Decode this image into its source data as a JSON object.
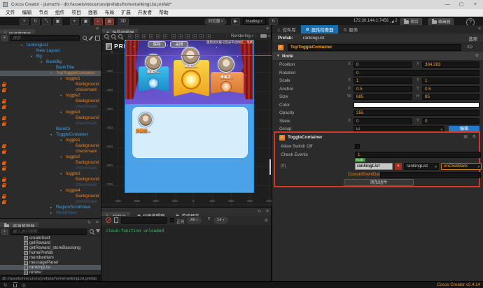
{
  "window": {
    "title": "Cocos Creator - jiumozhi - db://assets/resources/prefabs/home/rankingList.prefab*",
    "minimize": "—",
    "maximize": "▢",
    "close": "×"
  },
  "menu": {
    "items": [
      "文件",
      "编辑",
      "节点",
      "组件",
      "项目",
      "面板",
      "布局",
      "扩展",
      "开发者",
      "帮助"
    ]
  },
  "toolbar": {
    "preview_target": "浏览器",
    "play": "▶",
    "scene": "loading",
    "address": "172.30.144.1:7456",
    "device_count": "2",
    "project": "项目",
    "editor": "编辑器",
    "mode_3d": "3D"
  },
  "hierarchy": {
    "title": "层级管理器",
    "search_placeholder": "搜索...",
    "nodes": [
      {
        "label": "rankingList",
        "indent": 0,
        "arrow": "▾",
        "color": "blue"
      },
      {
        "label": "New Layout",
        "indent": 1,
        "arrow": "",
        "color": "blue"
      },
      {
        "label": "Bg",
        "indent": 1,
        "arrow": "▾",
        "color": "blue"
      },
      {
        "label": "BankBg",
        "indent": 2,
        "arrow": "▾",
        "color": "blue"
      },
      {
        "label": "BankTitle",
        "indent": 3,
        "arrow": "",
        "color": "blue"
      },
      {
        "label": "TopToggleContainer",
        "indent": 3,
        "arrow": "▾",
        "color": "orange",
        "selected": true
      },
      {
        "label": "toggle1",
        "indent": 4,
        "arrow": "▾",
        "color": "orange"
      },
      {
        "label": "Background",
        "indent": 5,
        "arrow": "",
        "color": "orange",
        "locked": true
      },
      {
        "label": "checkmark",
        "indent": 5,
        "arrow": "",
        "color": "orange",
        "locked": true
      },
      {
        "label": "toggle2",
        "indent": 4,
        "arrow": "▾",
        "color": "orange"
      },
      {
        "label": "Background",
        "indent": 5,
        "arrow": "",
        "color": "orange",
        "locked": true
      },
      {
        "label": "checkmark",
        "indent": 5,
        "arrow": "",
        "color": "dim",
        "locked": true
      },
      {
        "label": "toggle3",
        "indent": 4,
        "arrow": "▾",
        "color": "orange"
      },
      {
        "label": "Background",
        "indent": 5,
        "arrow": "",
        "color": "orange",
        "locked": true
      },
      {
        "label": "checkmark",
        "indent": 5,
        "arrow": "",
        "color": "dim",
        "locked": true
      },
      {
        "label": "BankDi",
        "indent": 3,
        "arrow": "",
        "color": "blue"
      },
      {
        "label": "ToggleContainer",
        "indent": 3,
        "arrow": "▾",
        "color": "blue"
      },
      {
        "label": "toggle1",
        "indent": 4,
        "arrow": "▾",
        "color": "orange"
      },
      {
        "label": "Background",
        "indent": 5,
        "arrow": "",
        "color": "orange",
        "locked": true
      },
      {
        "label": "checkmark",
        "indent": 5,
        "arrow": "",
        "color": "orange",
        "locked": true
      },
      {
        "label": "toggle2",
        "indent": 4,
        "arrow": "▾",
        "color": "orange"
      },
      {
        "label": "Background",
        "indent": 5,
        "arrow": "",
        "color": "orange",
        "locked": true
      },
      {
        "label": "checkmark",
        "indent": 5,
        "arrow": "",
        "color": "dim",
        "locked": true
      },
      {
        "label": "toggle3",
        "indent": 4,
        "arrow": "▾",
        "color": "orange"
      },
      {
        "label": "Background",
        "indent": 5,
        "arrow": "",
        "color": "orange",
        "locked": true
      },
      {
        "label": "checkmark",
        "indent": 5,
        "arrow": "",
        "color": "dim",
        "locked": true
      },
      {
        "label": "toggle4",
        "indent": 4,
        "arrow": "▾",
        "color": "orange"
      },
      {
        "label": "Background",
        "indent": 5,
        "arrow": "",
        "color": "orange",
        "locked": true
      },
      {
        "label": "checkmark",
        "indent": 5,
        "arrow": "",
        "color": "dim",
        "locked": true
      },
      {
        "label": "RegionScrollView",
        "indent": 3,
        "arrow": "▸",
        "color": "blue"
      },
      {
        "label": "WorldView",
        "indent": 3,
        "arrow": "▸",
        "color": "dimblue"
      }
    ]
  },
  "assets": {
    "title": "资源管理器",
    "search_placeholder": "输入进行搜索...",
    "items": [
      "createSect",
      "getReward",
      "getReward_storeBaoxiang",
      "homePrefab",
      "memberItem",
      "messagePanel",
      "rankingList",
      "renwu"
    ],
    "selected": "rankingList",
    "path": "db://assets/resources/prefabs/home/rankingList.prefab"
  },
  "scene": {
    "tab": "场景编辑器",
    "rendering": "Rendering",
    "watermark": "PREFAB",
    "save": "保存",
    "close": "关闭",
    "marquee": "使用试玩账号登录平台体验，免费领取绑定话费",
    "ruler_y": [
      "0",
      "-100",
      "-200",
      "-300",
      "-400",
      "-500",
      "-600",
      "-700"
    ],
    "ruler_x": [
      "-400",
      "-300",
      "-200",
      "-100",
      "0",
      "100",
      "200",
      "300",
      "400"
    ],
    "podiums": [
      {
        "label": "隶属庆...",
        "rank": "2"
      },
      {
        "label": "隶属拔...",
        "rank": "1"
      },
      {
        "label": "隶属拔...",
        "rank": "3"
      }
    ],
    "list_item": {
      "label": "隶属拔..."
    }
  },
  "console": {
    "tabs": [
      "控制台",
      "动画编辑器",
      "游戏预览"
    ],
    "regex": "正则",
    "filter": "All",
    "font_size": "14",
    "log": "cloud-function unloaded"
  },
  "inspector": {
    "tabs": [
      "控件库",
      "属性检查器",
      "服务"
    ],
    "prefab_label": "Prefab:",
    "prefab_name": "rankingList",
    "options": "选项",
    "node_name": "TopToggleContainer",
    "mode_3d": "3D",
    "section_node": "Node",
    "props": {
      "axis": {
        "x": "X",
        "y": "Y",
        "w": "W",
        "h": "H"
      },
      "position_label": "Position",
      "position_x": "0",
      "position_y": "384.283",
      "rotation_label": "Rotation",
      "rotation": "0",
      "scale_label": "Scale",
      "scale_x": "1",
      "scale_y": "1",
      "anchor_label": "Anchor",
      "anchor_x": "0.5",
      "anchor_y": "0.5",
      "size_label": "Size",
      "size_w": "685",
      "size_h": "85",
      "color_label": "Color",
      "opacity_label": "Opacity",
      "opacity": "255",
      "skew_label": "Skew",
      "skew_x": "0",
      "skew_y": "0",
      "group_label": "Group",
      "group": "ui",
      "group_edit": "编辑"
    },
    "toggle": {
      "name": "ToggleContainer",
      "allow_label": "Allow Switch Off",
      "events_label": "Check Events",
      "events_count": "1",
      "index": "[0]",
      "badge": "Node",
      "target": "rankingList",
      "component": "rankingList",
      "handler": "onClickBack",
      "custom_label": "CustomEventData"
    },
    "add_component": "添加组件"
  },
  "statusbar": {
    "version": "Cocos Creator v2.4.14"
  },
  "colors": {
    "accent_blue": "#1a6fae",
    "selection": "#4e565c",
    "node_blue": "#3f9fe8",
    "node_orange": "#e8832a",
    "red_outline": "#d93428",
    "value_orange": "#f0a030",
    "console_green": "#3fbf6f",
    "version_orange": "#e8963c"
  }
}
